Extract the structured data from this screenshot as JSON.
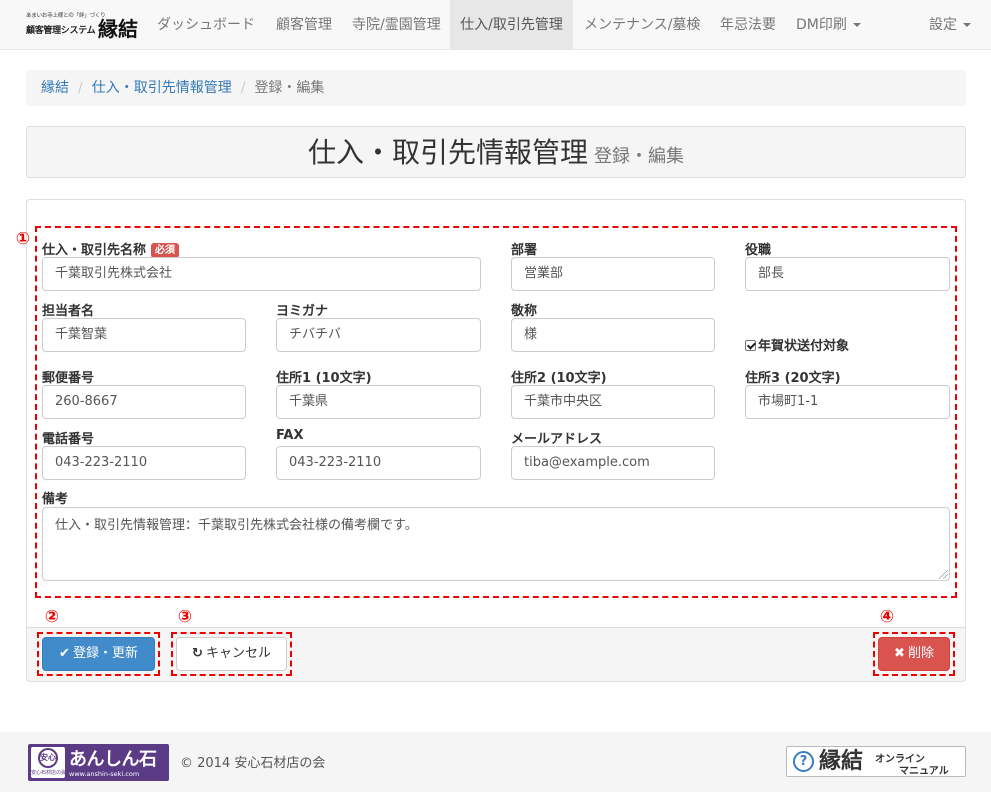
{
  "brand": {
    "tagline": "あまいお寺上様との「絆」づくり",
    "system": "顧客管理システム",
    "logo": "縁結"
  },
  "nav": {
    "items": [
      {
        "label": "ダッシュボード"
      },
      {
        "label": "顧客管理"
      },
      {
        "label": "寺院/霊園管理"
      },
      {
        "label": "仕入/取引先管理"
      },
      {
        "label": "メンテナンス/墓検"
      },
      {
        "label": "年忌法要"
      },
      {
        "label": "DM印刷"
      }
    ],
    "settings": "設定"
  },
  "breadcrumb": {
    "home": "縁結",
    "section": "仕入・取引先情報管理",
    "current": "登録・編集"
  },
  "header": {
    "title": "仕入・取引先情報管理",
    "subtitle": "登録・編集"
  },
  "markers": [
    "①",
    "②",
    "③",
    "④"
  ],
  "form": {
    "required_badge": "必須",
    "supplier_name": {
      "label": "仕入・取引先名称",
      "value": "千葉取引先株式会社"
    },
    "department": {
      "label": "部署",
      "value": "営業部"
    },
    "position": {
      "label": "役職",
      "value": "部長"
    },
    "contact_name": {
      "label": "担当者名",
      "value": "千葉智葉"
    },
    "kana": {
      "label": "ヨミガナ",
      "value": "チバチバ"
    },
    "honorific": {
      "label": "敬称",
      "value": "様"
    },
    "new_year_card": {
      "label": "年賀状送付対象",
      "checked": true
    },
    "postal": {
      "label": "郵便番号",
      "value": "260-8667"
    },
    "address1": {
      "label": "住所1 (10文字)",
      "value": "千葉県"
    },
    "address2": {
      "label": "住所2 (10文字)",
      "value": "千葉市中央区"
    },
    "address3": {
      "label": "住所3 (20文字)",
      "value": "市場町1-1"
    },
    "phone": {
      "label": "電話番号",
      "value": "043-223-2110"
    },
    "fax": {
      "label": "FAX",
      "value": "043-223-2110"
    },
    "email": {
      "label": "メールアドレス",
      "value": "tiba@example.com"
    },
    "notes": {
      "label": "備考",
      "value": "仕入・取引先情報管理：千葉取引先株式会社様の備考欄です。"
    }
  },
  "buttons": {
    "save": "登録・更新",
    "cancel": "キャンセル",
    "delete": "削除"
  },
  "footer": {
    "partner_badge": "安心",
    "partner_badge_sub": "安心石材店の会",
    "partner_name": "あんしん石",
    "partner_url": "www.anshin-seki.com",
    "copyright": "© 2014 安心石材店の会",
    "manual_logo": "縁結",
    "manual_line1": "オンライン",
    "manual_line2": "マニュアル"
  }
}
